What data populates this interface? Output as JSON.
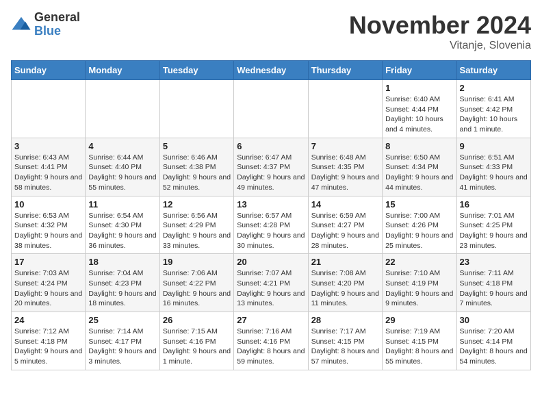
{
  "logo": {
    "general": "General",
    "blue": "Blue"
  },
  "title": "November 2024",
  "location": "Vitanje, Slovenia",
  "weekdays": [
    "Sunday",
    "Monday",
    "Tuesday",
    "Wednesday",
    "Thursday",
    "Friday",
    "Saturday"
  ],
  "weeks": [
    [
      {
        "day": "",
        "info": ""
      },
      {
        "day": "",
        "info": ""
      },
      {
        "day": "",
        "info": ""
      },
      {
        "day": "",
        "info": ""
      },
      {
        "day": "",
        "info": ""
      },
      {
        "day": "1",
        "info": "Sunrise: 6:40 AM\nSunset: 4:44 PM\nDaylight: 10 hours and 4 minutes."
      },
      {
        "day": "2",
        "info": "Sunrise: 6:41 AM\nSunset: 4:42 PM\nDaylight: 10 hours and 1 minute."
      }
    ],
    [
      {
        "day": "3",
        "info": "Sunrise: 6:43 AM\nSunset: 4:41 PM\nDaylight: 9 hours and 58 minutes."
      },
      {
        "day": "4",
        "info": "Sunrise: 6:44 AM\nSunset: 4:40 PM\nDaylight: 9 hours and 55 minutes."
      },
      {
        "day": "5",
        "info": "Sunrise: 6:46 AM\nSunset: 4:38 PM\nDaylight: 9 hours and 52 minutes."
      },
      {
        "day": "6",
        "info": "Sunrise: 6:47 AM\nSunset: 4:37 PM\nDaylight: 9 hours and 49 minutes."
      },
      {
        "day": "7",
        "info": "Sunrise: 6:48 AM\nSunset: 4:35 PM\nDaylight: 9 hours and 47 minutes."
      },
      {
        "day": "8",
        "info": "Sunrise: 6:50 AM\nSunset: 4:34 PM\nDaylight: 9 hours and 44 minutes."
      },
      {
        "day": "9",
        "info": "Sunrise: 6:51 AM\nSunset: 4:33 PM\nDaylight: 9 hours and 41 minutes."
      }
    ],
    [
      {
        "day": "10",
        "info": "Sunrise: 6:53 AM\nSunset: 4:32 PM\nDaylight: 9 hours and 38 minutes."
      },
      {
        "day": "11",
        "info": "Sunrise: 6:54 AM\nSunset: 4:30 PM\nDaylight: 9 hours and 36 minutes."
      },
      {
        "day": "12",
        "info": "Sunrise: 6:56 AM\nSunset: 4:29 PM\nDaylight: 9 hours and 33 minutes."
      },
      {
        "day": "13",
        "info": "Sunrise: 6:57 AM\nSunset: 4:28 PM\nDaylight: 9 hours and 30 minutes."
      },
      {
        "day": "14",
        "info": "Sunrise: 6:59 AM\nSunset: 4:27 PM\nDaylight: 9 hours and 28 minutes."
      },
      {
        "day": "15",
        "info": "Sunrise: 7:00 AM\nSunset: 4:26 PM\nDaylight: 9 hours and 25 minutes."
      },
      {
        "day": "16",
        "info": "Sunrise: 7:01 AM\nSunset: 4:25 PM\nDaylight: 9 hours and 23 minutes."
      }
    ],
    [
      {
        "day": "17",
        "info": "Sunrise: 7:03 AM\nSunset: 4:24 PM\nDaylight: 9 hours and 20 minutes."
      },
      {
        "day": "18",
        "info": "Sunrise: 7:04 AM\nSunset: 4:23 PM\nDaylight: 9 hours and 18 minutes."
      },
      {
        "day": "19",
        "info": "Sunrise: 7:06 AM\nSunset: 4:22 PM\nDaylight: 9 hours and 16 minutes."
      },
      {
        "day": "20",
        "info": "Sunrise: 7:07 AM\nSunset: 4:21 PM\nDaylight: 9 hours and 13 minutes."
      },
      {
        "day": "21",
        "info": "Sunrise: 7:08 AM\nSunset: 4:20 PM\nDaylight: 9 hours and 11 minutes."
      },
      {
        "day": "22",
        "info": "Sunrise: 7:10 AM\nSunset: 4:19 PM\nDaylight: 9 hours and 9 minutes."
      },
      {
        "day": "23",
        "info": "Sunrise: 7:11 AM\nSunset: 4:18 PM\nDaylight: 9 hours and 7 minutes."
      }
    ],
    [
      {
        "day": "24",
        "info": "Sunrise: 7:12 AM\nSunset: 4:18 PM\nDaylight: 9 hours and 5 minutes."
      },
      {
        "day": "25",
        "info": "Sunrise: 7:14 AM\nSunset: 4:17 PM\nDaylight: 9 hours and 3 minutes."
      },
      {
        "day": "26",
        "info": "Sunrise: 7:15 AM\nSunset: 4:16 PM\nDaylight: 9 hours and 1 minute."
      },
      {
        "day": "27",
        "info": "Sunrise: 7:16 AM\nSunset: 4:16 PM\nDaylight: 8 hours and 59 minutes."
      },
      {
        "day": "28",
        "info": "Sunrise: 7:17 AM\nSunset: 4:15 PM\nDaylight: 8 hours and 57 minutes."
      },
      {
        "day": "29",
        "info": "Sunrise: 7:19 AM\nSunset: 4:15 PM\nDaylight: 8 hours and 55 minutes."
      },
      {
        "day": "30",
        "info": "Sunrise: 7:20 AM\nSunset: 4:14 PM\nDaylight: 8 hours and 54 minutes."
      }
    ]
  ]
}
